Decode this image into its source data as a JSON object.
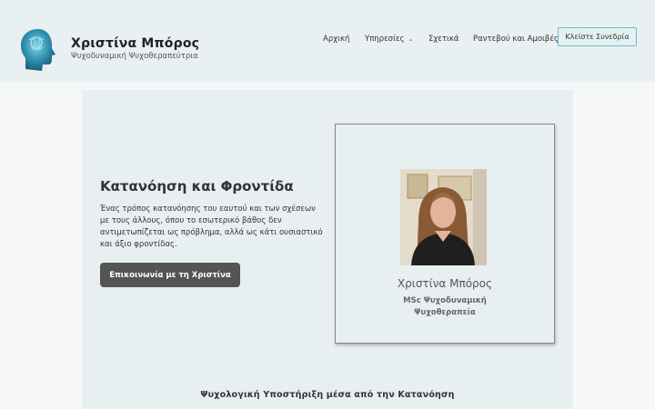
{
  "header": {
    "site_title": "Χριστίνα Μπόρος",
    "tagline": "Ψυχοδυναμική Ψυχοθεραπεύτρια",
    "logo_icon": "head-brain-icon"
  },
  "nav": {
    "home": "Αρχική",
    "services": "Υπηρεσίες",
    "services_icon": "chevron-down-icon",
    "about": "Σχετικά",
    "appointments": "Ραντεβού και Αμοιβές",
    "cta": "Κλείστε Συνεδρία"
  },
  "hero": {
    "title": "Κατανόηση και Φροντίδα",
    "text": "Ένας τρόπος κατανόησης του εαυτού και των σχέσεων με τους άλλους, όπου το εσωτερικό βάθος δεν αντιμετωπίζεται ως πρόβλημα, αλλά ως κάτι ουσιαστικό και άξιο φροντίδας.",
    "button": "Επικοινωνία με τη Χριστίνα"
  },
  "card": {
    "name": "Χριστίνα Μπόρος",
    "subtitle_line1": "MSc Ψυχοδυναμική",
    "subtitle_line2": "Ψυχοθεραπεία"
  },
  "section": {
    "heading": "Ψυχολογική Υποστήριξη μέσα από την Κατανόηση"
  },
  "colors": {
    "header_bg": "#e9f0f2",
    "content_bg": "#e8eff1",
    "accent": "#6bbcc8",
    "button_dark": "#545454"
  }
}
